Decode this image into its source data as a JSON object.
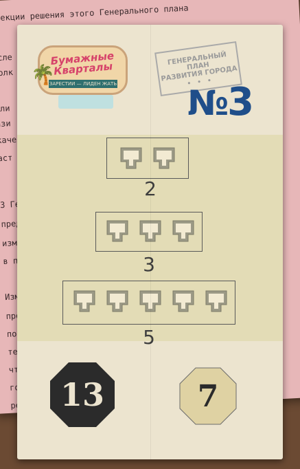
{
  "background_text": [
    "осекции решения этого Генерального плана",
    "осле",
    "золк",
    "оли",
    "ази",
    "каче",
    "аст",
    "3 Ге",
    "пред",
    "измо",
    "в п",
    "Изм",
    "про",
    "по-",
    "тер",
    "что",
    "го",
    "ре"
  ],
  "logo": {
    "title": "Бумажные Кварталы",
    "subtitle": "ЗАРЕСТИИ — ЛИДЕН ЖАТЬ"
  },
  "stamp": {
    "line1": "ГЕНЕРАЛЬНЫЙ ПЛАН",
    "line2": "РАЗВИТИЯ ГОРОДА",
    "dots": "• • •"
  },
  "card": {
    "number_sign": "№",
    "number": "3"
  },
  "groups": [
    {
      "size": 2,
      "label": "2"
    },
    {
      "size": 3,
      "label": "3"
    },
    {
      "size": 5,
      "label": "5"
    }
  ],
  "scores": {
    "first": "13",
    "second": "7"
  },
  "colors": {
    "card": "#ece4cf",
    "number": "#1f4e8a",
    "first_token": "#2b2b2b",
    "second_token": "#dfd2a3"
  }
}
